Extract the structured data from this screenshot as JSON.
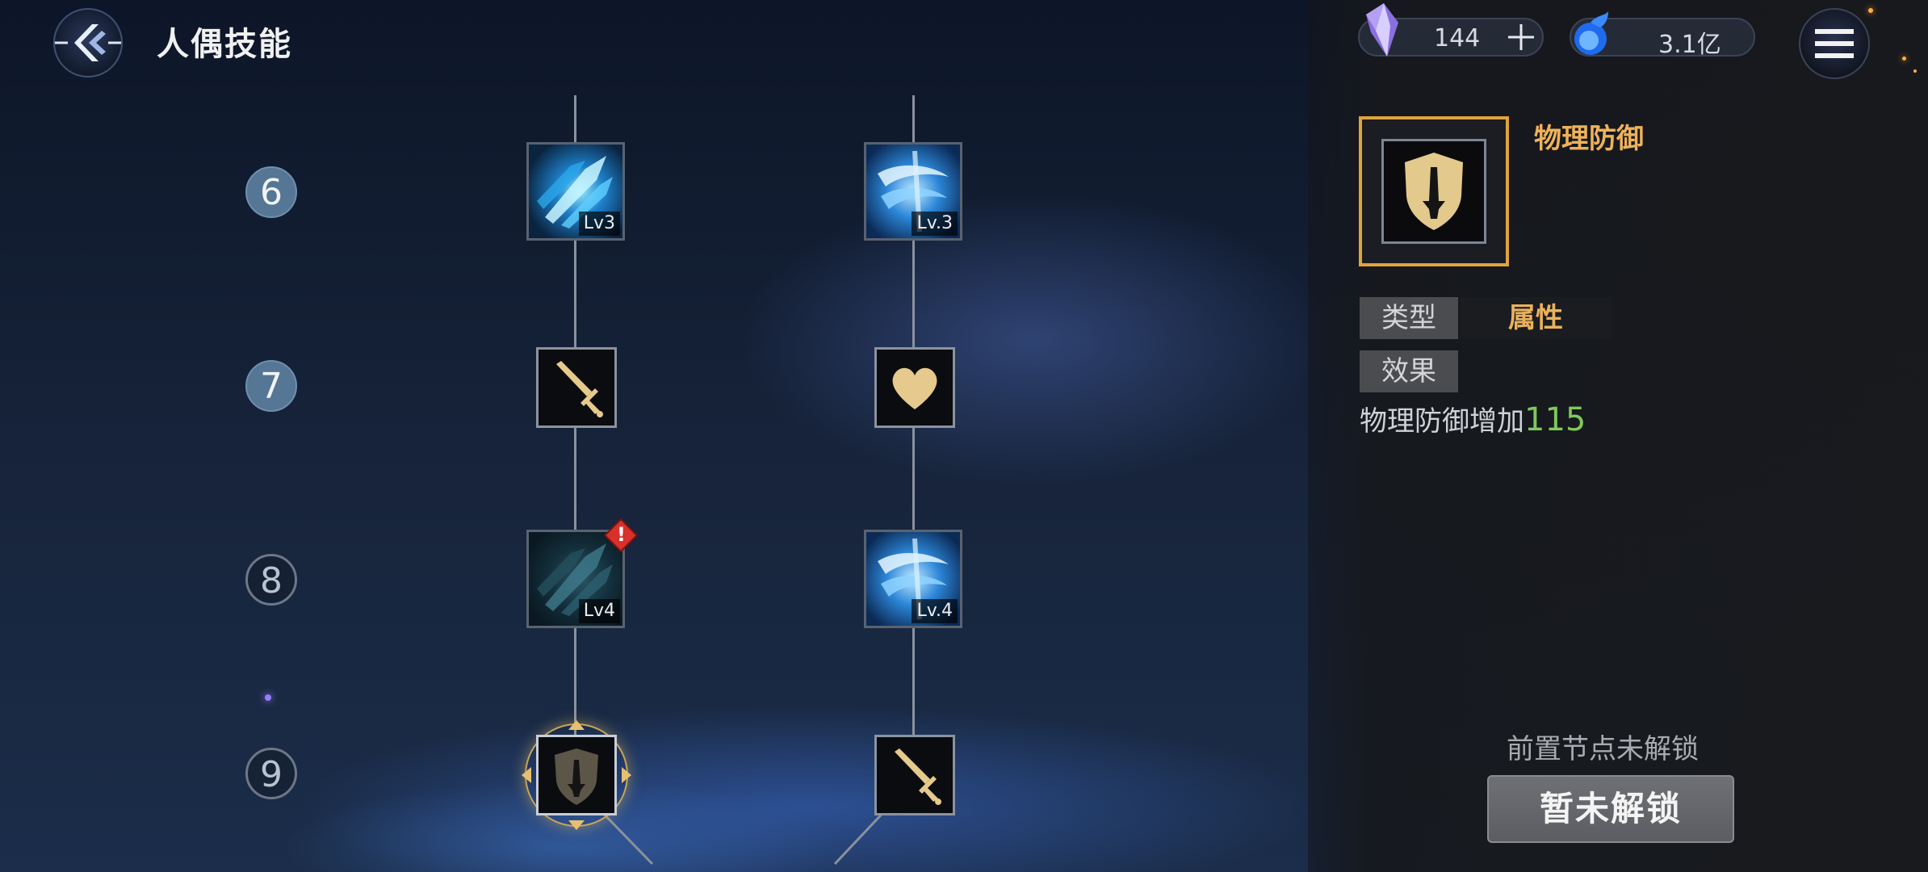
{
  "header": {
    "title": "人偶技能",
    "back_icon": "back-arrow-icon",
    "menu_icon": "hamburger-menu-icon"
  },
  "currencies": {
    "crystal": {
      "icon": "purple-crystal-icon",
      "value": "144",
      "add_icon": "plus-icon"
    },
    "essence": {
      "icon": "blue-flame-orb-icon",
      "value": "3.1亿"
    }
  },
  "tree": {
    "rows": [
      {
        "num": "6",
        "state": "done",
        "left": {
          "icon": "blue-claw-slash-skill-icon",
          "level": "Lv3"
        },
        "right": {
          "icon": "blue-vortex-skill-icon",
          "level": "Lv.3"
        }
      },
      {
        "num": "7",
        "state": "done",
        "left": {
          "icon": "sword-attack-icon"
        },
        "right": {
          "icon": "heart-icon"
        }
      },
      {
        "num": "8",
        "state": "todo",
        "left": {
          "icon": "dim-claw-slash-skill-icon",
          "level": "Lv4",
          "alert": "!"
        },
        "right": {
          "icon": "blue-vortex-skill-icon",
          "level": "Lv.4"
        }
      },
      {
        "num": "9",
        "state": "todo",
        "left": {
          "icon": "shield-defense-icon",
          "selected": true
        },
        "right": {
          "icon": "sword-attack-icon"
        }
      }
    ]
  },
  "detail": {
    "icon": "shield-defense-icon",
    "name": "物理防御",
    "type_label": "类型",
    "type_value": "属性",
    "effect_label": "效果",
    "effect_text": "物理防御增加",
    "effect_value": "115",
    "prereq_text": "前置节点未解锁",
    "button_label": "暂未解锁"
  },
  "colors": {
    "accent_gold": "#efb25a",
    "effect_green": "#7ec95a",
    "node_gold": "#e6c98c"
  }
}
